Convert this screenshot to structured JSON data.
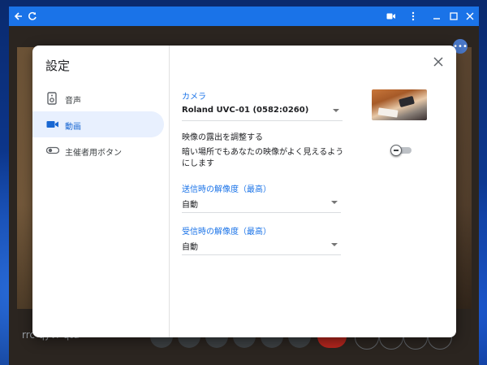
{
  "window": {
    "titlebar_color": "#1a73e8",
    "left_icons": [
      "back-icon",
      "refresh-icon"
    ],
    "right_icons": [
      "camera-icon",
      "more-vert-icon",
      "minimize-icon",
      "maximize-icon",
      "close-icon"
    ]
  },
  "meeting": {
    "code": "rrc-qyvr-qtu"
  },
  "dialog": {
    "title": "設定",
    "nav": [
      {
        "label": "音声",
        "icon": "speaker-icon",
        "active": false
      },
      {
        "label": "動画",
        "icon": "videocam-icon",
        "active": true
      },
      {
        "label": "主催者用ボタン",
        "icon": "toggle-icon",
        "active": false
      }
    ],
    "camera": {
      "label": "カメラ",
      "selected": "Roland UVC-01 (0582:0260)"
    },
    "exposure": {
      "title": "映像の露出を調整する",
      "description": "暗い場所でもあなたの映像がよく見えるようにします",
      "enabled": false
    },
    "send_resolution": {
      "label": "送信時の解像度（最高）",
      "selected": "自動"
    },
    "receive_resolution": {
      "label": "受信時の解像度（最高）",
      "selected": "自動"
    },
    "accent_color": "#1a73e8",
    "active_nav_bg": "#e8f0fe"
  }
}
